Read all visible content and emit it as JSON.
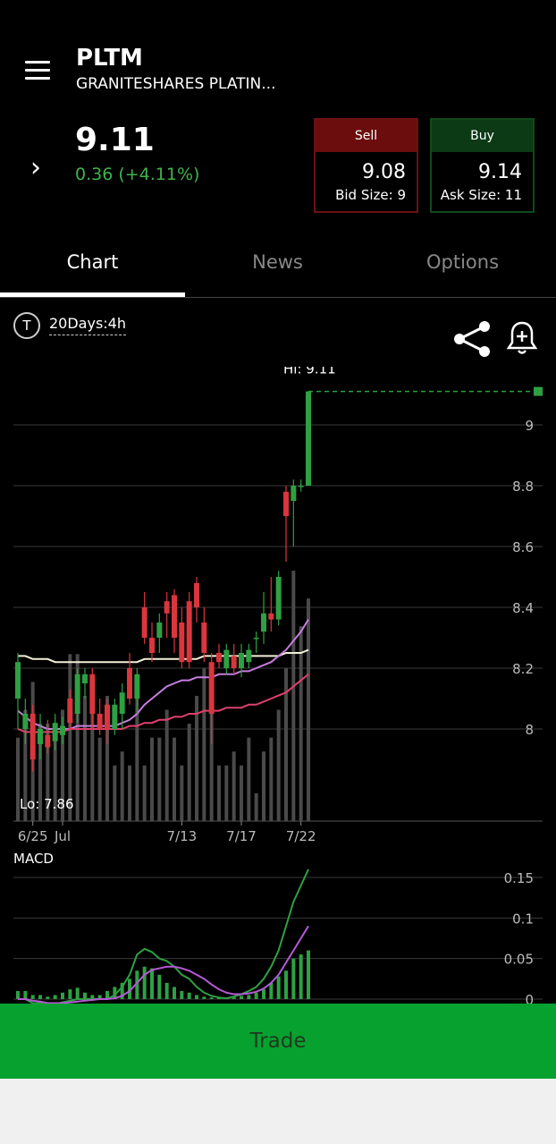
{
  "header": {
    "ticker": "PLTM",
    "name": "GRANITESHARES PLATIN...",
    "menu_icon": "hamburger-menu-icon",
    "expand_icon": "chevron-right-icon"
  },
  "quote": {
    "price": "9.11",
    "change": "0.36 (+4.11%)",
    "change_color": "#3fb44b",
    "sell": {
      "label": "Sell",
      "price": "9.08",
      "size": "Bid Size: 9"
    },
    "buy": {
      "label": "Buy",
      "price": "9.14",
      "size": "Ask Size: 11"
    }
  },
  "tabs": [
    {
      "label": "Chart",
      "active": true
    },
    {
      "label": "News",
      "active": false
    },
    {
      "label": "Options",
      "active": false
    }
  ],
  "toolbar": {
    "badge_letter": "T",
    "interval": "20Days:4h",
    "share_icon": "share-icon",
    "alert_icon": "bell-plus-icon"
  },
  "chart_data": {
    "type": "candlestick",
    "hi_label": "Hi: 9.11",
    "lo_label": "Lo: 7.86",
    "last_price": 9.11,
    "y_ticks": [
      9,
      8.8,
      8.6,
      8.4,
      8.2,
      8
    ],
    "x_labels": [
      "6/25",
      "Jul",
      "7/13",
      "7/17",
      "7/22"
    ],
    "up_color": "#2ea043",
    "down_color": "#d9363e",
    "candles": [
      {
        "o": 8.1,
        "h": 8.25,
        "l": 8.0,
        "c": 8.22
      },
      {
        "o": 8.0,
        "h": 8.1,
        "l": 7.95,
        "c": 8.05
      },
      {
        "o": 8.05,
        "h": 8.08,
        "l": 7.86,
        "c": 7.9
      },
      {
        "o": 7.95,
        "h": 8.05,
        "l": 7.9,
        "c": 8.0
      },
      {
        "o": 7.98,
        "h": 8.03,
        "l": 7.92,
        "c": 7.94
      },
      {
        "o": 7.96,
        "h": 8.05,
        "l": 7.93,
        "c": 8.02
      },
      {
        "o": 7.98,
        "h": 8.04,
        "l": 7.95,
        "c": 8.01
      },
      {
        "o": 8.1,
        "h": 8.13,
        "l": 8.0,
        "c": 8.02
      },
      {
        "o": 8.05,
        "h": 8.2,
        "l": 8.02,
        "c": 8.18
      },
      {
        "o": 8.15,
        "h": 8.2,
        "l": 8.1,
        "c": 8.18
      },
      {
        "o": 8.18,
        "h": 8.2,
        "l": 8.0,
        "c": 8.05
      },
      {
        "o": 8.05,
        "h": 8.1,
        "l": 7.98,
        "c": 8.0
      },
      {
        "o": 8.08,
        "h": 8.1,
        "l": 7.95,
        "c": 8.0
      },
      {
        "o": 8.0,
        "h": 8.1,
        "l": 7.98,
        "c": 8.08
      },
      {
        "o": 8.05,
        "h": 8.15,
        "l": 8.0,
        "c": 8.12
      },
      {
        "o": 8.2,
        "h": 8.25,
        "l": 8.08,
        "c": 8.1
      },
      {
        "o": 8.1,
        "h": 8.2,
        "l": 8.05,
        "c": 8.18
      },
      {
        "o": 8.4,
        "h": 8.45,
        "l": 8.28,
        "c": 8.3
      },
      {
        "o": 8.3,
        "h": 8.35,
        "l": 8.22,
        "c": 8.25
      },
      {
        "o": 8.3,
        "h": 8.38,
        "l": 8.25,
        "c": 8.35
      },
      {
        "o": 8.42,
        "h": 8.45,
        "l": 8.3,
        "c": 8.38
      },
      {
        "o": 8.44,
        "h": 8.46,
        "l": 8.25,
        "c": 8.3
      },
      {
        "o": 8.35,
        "h": 8.4,
        "l": 8.2,
        "c": 8.22
      },
      {
        "o": 8.42,
        "h": 8.45,
        "l": 8.2,
        "c": 8.22
      },
      {
        "o": 8.48,
        "h": 8.5,
        "l": 8.35,
        "c": 8.4
      },
      {
        "o": 8.35,
        "h": 8.4,
        "l": 8.22,
        "c": 8.25
      },
      {
        "o": 8.22,
        "h": 8.25,
        "l": 7.95,
        "c": 8.05
      },
      {
        "o": 8.25,
        "h": 8.28,
        "l": 8.2,
        "c": 8.22
      },
      {
        "o": 8.2,
        "h": 8.28,
        "l": 8.18,
        "c": 8.26
      },
      {
        "o": 8.24,
        "h": 8.28,
        "l": 8.18,
        "c": 8.2
      },
      {
        "o": 8.2,
        "h": 8.28,
        "l": 8.17,
        "c": 8.25
      },
      {
        "o": 8.22,
        "h": 8.28,
        "l": 8.2,
        "c": 8.26
      },
      {
        "o": 8.3,
        "h": 8.32,
        "l": 8.25,
        "c": 8.3
      },
      {
        "o": 8.32,
        "h": 8.45,
        "l": 8.28,
        "c": 8.38
      },
      {
        "o": 8.38,
        "h": 8.5,
        "l": 8.32,
        "c": 8.36
      },
      {
        "o": 8.36,
        "h": 8.52,
        "l": 8.34,
        "c": 8.5
      },
      {
        "o": 8.78,
        "h": 8.8,
        "l": 8.55,
        "c": 8.7
      },
      {
        "o": 8.75,
        "h": 8.82,
        "l": 8.6,
        "c": 8.8
      },
      {
        "o": 8.8,
        "h": 8.82,
        "l": 8.78,
        "c": 8.8
      },
      {
        "o": 8.8,
        "h": 9.11,
        "l": 8.8,
        "c": 9.11
      }
    ],
    "volume": [
      30,
      40,
      50,
      35,
      35,
      35,
      40,
      60,
      60,
      45,
      40,
      30,
      45,
      20,
      25,
      20,
      45,
      20,
      30,
      30,
      40,
      30,
      20,
      35,
      45,
      55,
      50,
      20,
      20,
      25,
      20,
      30,
      10,
      25,
      30,
      40,
      55,
      90,
      70,
      80
    ],
    "ma_white": [
      8.24,
      8.24,
      8.23,
      8.23,
      8.23,
      8.22,
      8.22,
      8.22,
      8.22,
      8.22,
      8.22,
      8.22,
      8.22,
      8.22,
      8.22,
      8.22,
      8.22,
      8.23,
      8.23,
      8.23,
      8.23,
      8.23,
      8.23,
      8.23,
      8.23,
      8.24,
      8.24,
      8.24,
      8.24,
      8.24,
      8.24,
      8.24,
      8.24,
      8.24,
      8.24,
      8.24,
      8.25,
      8.25,
      8.25,
      8.26
    ],
    "ma_purple": [
      8.06,
      8.04,
      8.02,
      8.01,
      8.0,
      8.0,
      8.0,
      8.0,
      8.01,
      8.01,
      8.01,
      8.01,
      8.01,
      8.01,
      8.02,
      8.03,
      8.05,
      8.08,
      8.1,
      8.12,
      8.14,
      8.15,
      8.16,
      8.16,
      8.17,
      8.17,
      8.17,
      8.18,
      8.18,
      8.18,
      8.19,
      8.19,
      8.2,
      8.21,
      8.22,
      8.24,
      8.26,
      8.29,
      8.32,
      8.36
    ],
    "ma_pink": [
      8.0,
      7.99,
      7.99,
      7.99,
      7.99,
      7.99,
      7.99,
      8.0,
      8.0,
      8.0,
      8.0,
      8.0,
      8.0,
      8.0,
      8.0,
      8.01,
      8.01,
      8.02,
      8.02,
      8.03,
      8.03,
      8.04,
      8.04,
      8.05,
      8.05,
      8.06,
      8.06,
      8.06,
      8.07,
      8.07,
      8.07,
      8.08,
      8.08,
      8.09,
      8.1,
      8.11,
      8.12,
      8.14,
      8.16,
      8.18
    ],
    "macd": {
      "title": "MACD",
      "y_ticks": [
        0.15,
        0.1,
        0.05,
        0
      ],
      "histogram": [
        0.01,
        0.01,
        0.005,
        0.005,
        0.003,
        0.005,
        0.008,
        0.012,
        0.014,
        0.008,
        0.005,
        0.005,
        0.01,
        0.015,
        0.02,
        0.025,
        0.035,
        0.04,
        0.038,
        0.03,
        0.02,
        0.015,
        0.01,
        0.008,
        0.005,
        0.003,
        0.002,
        0.002,
        0.002,
        0.003,
        0.004,
        0.005,
        0.008,
        0.012,
        0.02,
        0.028,
        0.035,
        0.05,
        0.055,
        0.06
      ],
      "macd_line": [
        0.0,
        0.0,
        -0.005,
        -0.005,
        -0.008,
        -0.006,
        -0.004,
        -0.002,
        0.0,
        0.0,
        0.0,
        0.0,
        0.0,
        0.005,
        0.015,
        0.03,
        0.055,
        0.062,
        0.058,
        0.05,
        0.047,
        0.04,
        0.03,
        0.025,
        0.015,
        0.008,
        0.004,
        0.002,
        0.001,
        0.003,
        0.006,
        0.01,
        0.015,
        0.025,
        0.04,
        0.06,
        0.09,
        0.12,
        0.14,
        0.16
      ],
      "signal_line": [
        0.0,
        0.0,
        -0.002,
        -0.003,
        -0.005,
        -0.005,
        -0.005,
        -0.004,
        -0.003,
        -0.002,
        -0.001,
        0.0,
        0.0,
        0.001,
        0.004,
        0.01,
        0.02,
        0.03,
        0.036,
        0.038,
        0.04,
        0.04,
        0.038,
        0.035,
        0.03,
        0.025,
        0.018,
        0.012,
        0.008,
        0.006,
        0.006,
        0.007,
        0.009,
        0.013,
        0.02,
        0.03,
        0.045,
        0.06,
        0.075,
        0.09
      ]
    }
  },
  "trade_button": {
    "label": "Trade"
  }
}
